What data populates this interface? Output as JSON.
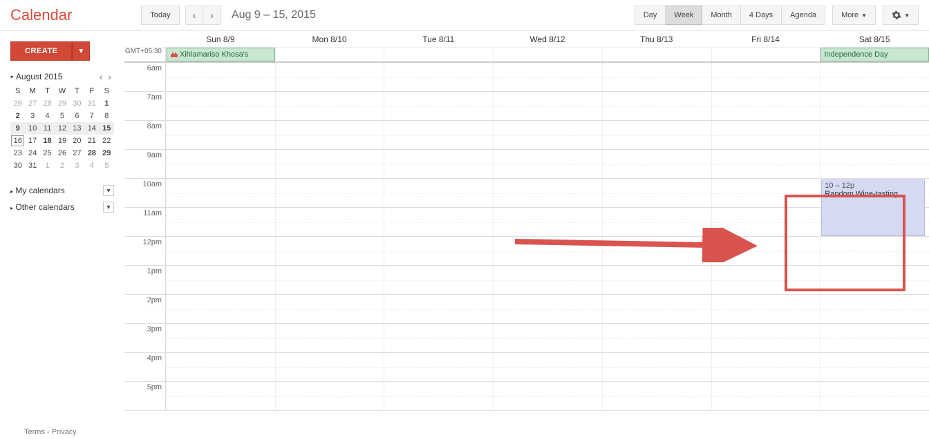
{
  "logo": "Calendar",
  "toolbar": {
    "today": "Today",
    "date_range": "Aug 9 – 15, 2015",
    "views": [
      "Day",
      "Week",
      "Month",
      "4 Days",
      "Agenda"
    ],
    "active_view": "Week",
    "more": "More"
  },
  "create_label": "CREATE",
  "minical": {
    "title": "August 2015",
    "dow": [
      "S",
      "M",
      "T",
      "W",
      "T",
      "F",
      "S"
    ],
    "weeks": [
      {
        "days": [
          {
            "d": "26",
            "o": true
          },
          {
            "d": "27",
            "o": true
          },
          {
            "d": "28",
            "o": true
          },
          {
            "d": "29",
            "o": true
          },
          {
            "d": "30",
            "o": true
          },
          {
            "d": "31",
            "o": true
          },
          {
            "d": "1",
            "b": true
          }
        ]
      },
      {
        "days": [
          {
            "d": "2",
            "b": true
          },
          {
            "d": "3"
          },
          {
            "d": "4"
          },
          {
            "d": "5"
          },
          {
            "d": "6"
          },
          {
            "d": "7"
          },
          {
            "d": "8"
          }
        ]
      },
      {
        "hl": true,
        "days": [
          {
            "d": "9",
            "b": true
          },
          {
            "d": "10"
          },
          {
            "d": "11"
          },
          {
            "d": "12"
          },
          {
            "d": "13"
          },
          {
            "d": "14"
          },
          {
            "d": "15",
            "b": true
          }
        ]
      },
      {
        "days": [
          {
            "d": "16",
            "today": true
          },
          {
            "d": "17"
          },
          {
            "d": "18",
            "b": true
          },
          {
            "d": "19"
          },
          {
            "d": "20"
          },
          {
            "d": "21"
          },
          {
            "d": "22"
          }
        ]
      },
      {
        "days": [
          {
            "d": "23"
          },
          {
            "d": "24"
          },
          {
            "d": "25"
          },
          {
            "d": "26"
          },
          {
            "d": "27"
          },
          {
            "d": "28",
            "b": true
          },
          {
            "d": "29",
            "b": true
          }
        ]
      },
      {
        "days": [
          {
            "d": "30"
          },
          {
            "d": "31"
          },
          {
            "d": "1",
            "o": true
          },
          {
            "d": "2",
            "o": true
          },
          {
            "d": "3",
            "o": true
          },
          {
            "d": "4",
            "o": true
          },
          {
            "d": "5",
            "o": true
          }
        ]
      }
    ]
  },
  "side": {
    "my": "My calendars",
    "other": "Other calendars"
  },
  "tz": "GMT+05:30",
  "days": [
    "Sun 8/9",
    "Mon 8/10",
    "Tue 8/11",
    "Wed 8/12",
    "Thu 8/13",
    "Fri 8/14",
    "Sat 8/15"
  ],
  "allday": {
    "sun": "Xihlamariso Khosa's",
    "sat": "Independence Day"
  },
  "hours": [
    "6am",
    "7am",
    "8am",
    "9am",
    "10am",
    "11am",
    "12pm",
    "1pm",
    "2pm",
    "3pm",
    "4pm",
    "5pm"
  ],
  "event": {
    "time": "10 – 12p",
    "title": "Random Wine-tasting"
  },
  "footer": "Terms - Privacy"
}
